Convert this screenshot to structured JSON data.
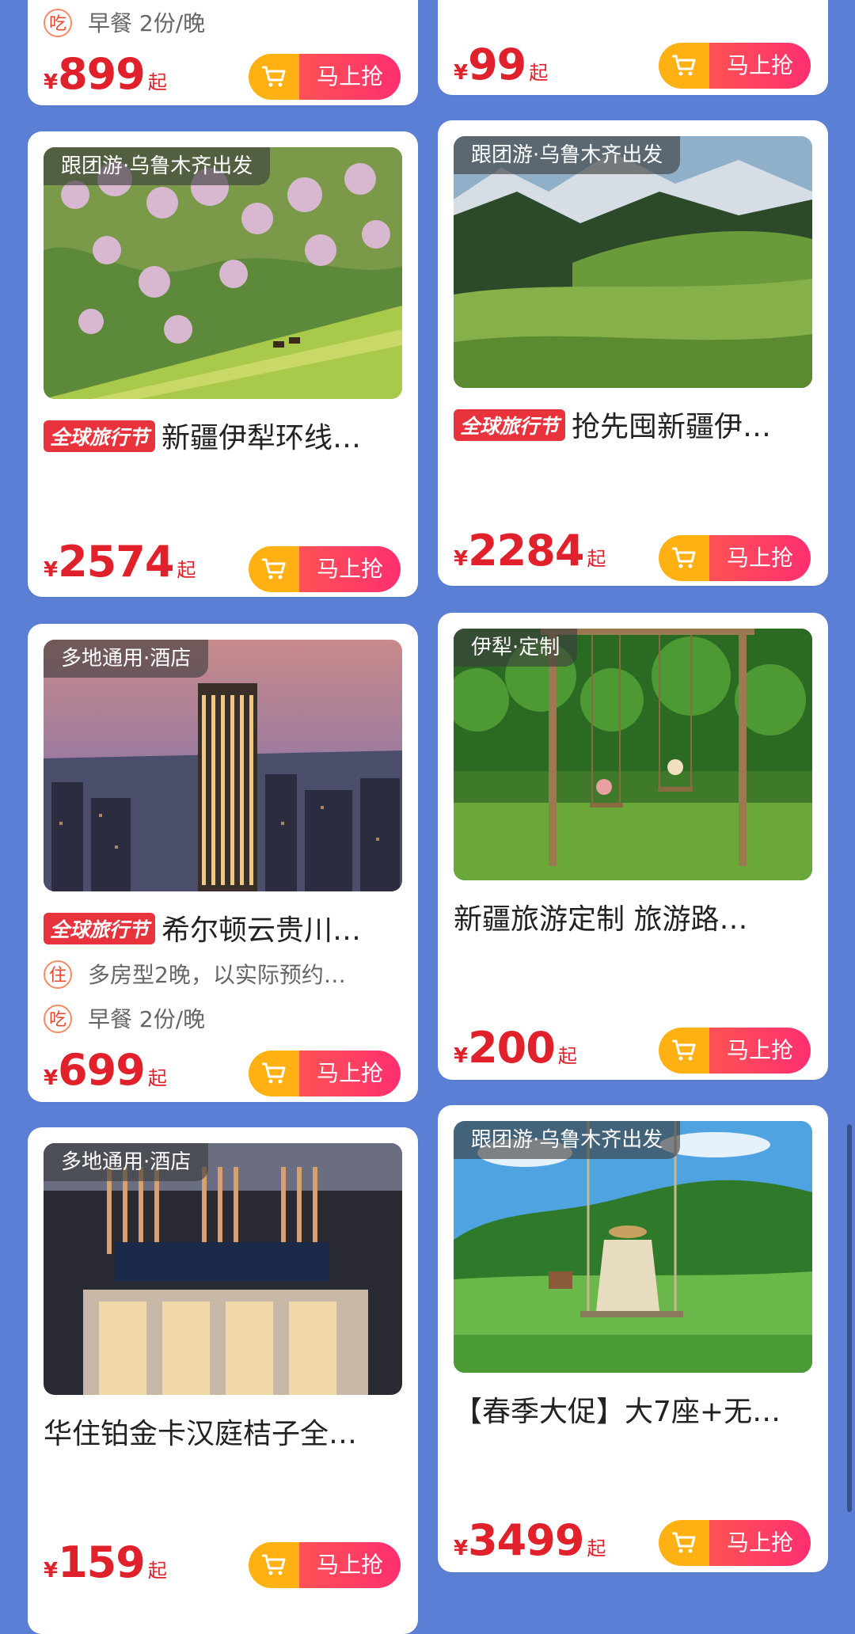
{
  "buy_label": "马上抢",
  "currency": "¥",
  "qi": "起",
  "top_left": {
    "info_icon": "吃",
    "info": "早餐 2份/晚",
    "price": "899"
  },
  "top_right": {
    "price": "99"
  },
  "cards": [
    {
      "tag": "跟团游·乌鲁木齐出发",
      "badge": "全球旅行节",
      "title": "新疆伊犁环线…",
      "price": "2574"
    },
    {
      "tag": "跟团游·乌鲁木齐出发",
      "badge": "全球旅行节",
      "title": "抢先囤新疆伊…",
      "price": "2284"
    },
    {
      "tag": "多地通用·酒店",
      "badge": "全球旅行节",
      "title": "希尔顿云贵川…",
      "info1_icon": "住",
      "info1": "多房型2晚，以实际预约…",
      "info2_icon": "吃",
      "info2": "早餐 2份/晚",
      "price": "699"
    },
    {
      "tag": "伊犁·定制",
      "title": "新疆旅游定制 旅游路…",
      "price": "200"
    },
    {
      "tag": "多地通用·酒店",
      "title": "华住铂金卡汉庭桔子全…",
      "price": "159"
    },
    {
      "tag": "跟团游·乌鲁木齐出发",
      "title": "【春季大促】大7座+无…",
      "price": "3499"
    }
  ],
  "colors": {
    "page_bg": "#5b7fd4",
    "price": "#e0202a",
    "badge": "#e8323c",
    "cart_btn": "#ffb114",
    "buy_btn": "#ff3a66"
  }
}
